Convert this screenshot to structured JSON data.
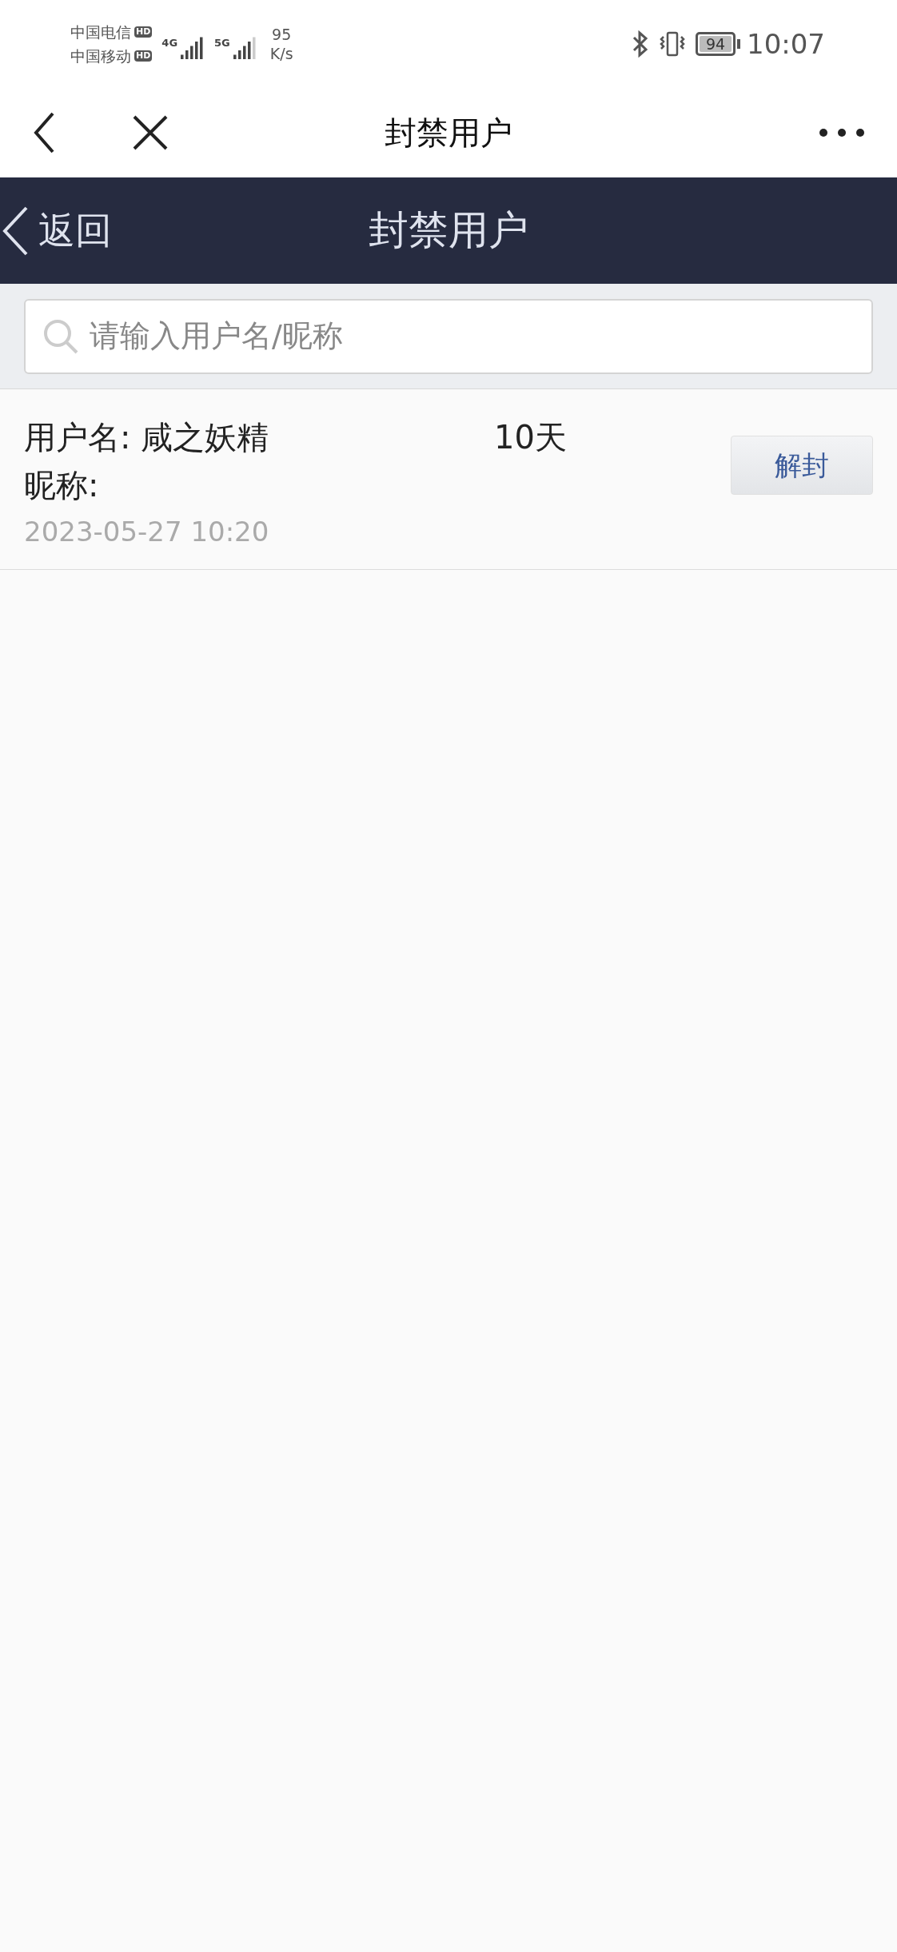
{
  "status_bar": {
    "carriers": [
      {
        "name": "中国电信",
        "badge": "HD",
        "network": "4G"
      },
      {
        "name": "中国移动",
        "badge": "HD",
        "network": "5G"
      }
    ],
    "speed_value": "95",
    "speed_unit": "K/s",
    "battery": "94",
    "time": "10:07"
  },
  "nav_bar": {
    "title": "封禁用户"
  },
  "header": {
    "back_label": "返回",
    "title": "封禁用户"
  },
  "search": {
    "placeholder": "请输入用户名/昵称"
  },
  "rows": [
    {
      "username": "用户名: 咸之妖精",
      "nickname": "昵称:",
      "duration": "10天",
      "date": "2023-05-27 10:20",
      "button": "解封"
    }
  ]
}
